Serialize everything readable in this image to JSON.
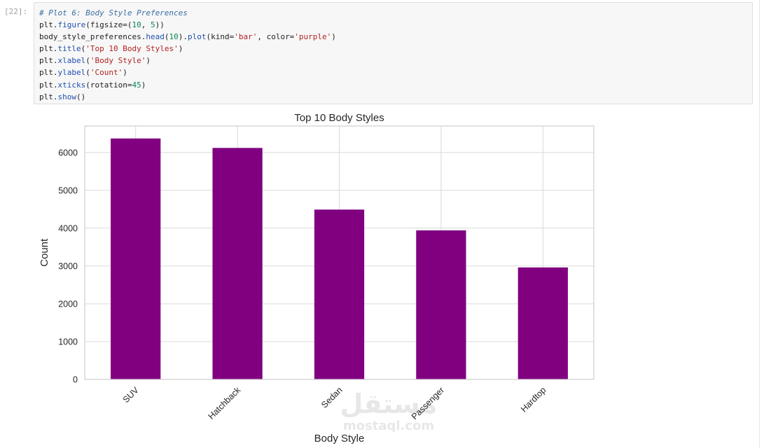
{
  "cell": {
    "prompt": "[22]:",
    "code_lines": [
      [
        {
          "t": "# Plot 6: Body Style Preferences",
          "c": "cm"
        }
      ],
      [
        {
          "t": "plt."
        },
        {
          "t": "figure",
          "c": "fn"
        },
        {
          "t": "(figsize=("
        },
        {
          "t": "10",
          "c": "nm"
        },
        {
          "t": ", "
        },
        {
          "t": "5",
          "c": "nm"
        },
        {
          "t": "))"
        }
      ],
      [
        {
          "t": "body_style_preferences."
        },
        {
          "t": "head",
          "c": "fn"
        },
        {
          "t": "("
        },
        {
          "t": "10",
          "c": "nm"
        },
        {
          "t": ")."
        },
        {
          "t": "plot",
          "c": "fn"
        },
        {
          "t": "(kind="
        },
        {
          "t": "'bar'",
          "c": "st"
        },
        {
          "t": ", color="
        },
        {
          "t": "'purple'",
          "c": "st"
        },
        {
          "t": ")"
        }
      ],
      [
        {
          "t": "plt."
        },
        {
          "t": "title",
          "c": "fn"
        },
        {
          "t": "("
        },
        {
          "t": "'Top 10 Body Styles'",
          "c": "st"
        },
        {
          "t": ")"
        }
      ],
      [
        {
          "t": "plt."
        },
        {
          "t": "xlabel",
          "c": "fn"
        },
        {
          "t": "("
        },
        {
          "t": "'Body Style'",
          "c": "st"
        },
        {
          "t": ")"
        }
      ],
      [
        {
          "t": "plt."
        },
        {
          "t": "ylabel",
          "c": "fn"
        },
        {
          "t": "("
        },
        {
          "t": "'Count'",
          "c": "st"
        },
        {
          "t": ")"
        }
      ],
      [
        {
          "t": "plt."
        },
        {
          "t": "xticks",
          "c": "fn"
        },
        {
          "t": "(rotation="
        },
        {
          "t": "45",
          "c": "nm"
        },
        {
          "t": ")"
        }
      ],
      [
        {
          "t": "plt."
        },
        {
          "t": "show",
          "c": "fn"
        },
        {
          "t": "()"
        }
      ]
    ]
  },
  "watermark": {
    "main": "مستقل",
    "sub": "mostaql.com"
  },
  "chart_data": {
    "type": "bar",
    "title": "Top 10 Body Styles",
    "xlabel": "Body Style",
    "ylabel": "Count",
    "categories": [
      "SUV",
      "Hatchback",
      "Sedan",
      "Passenger",
      "Hardtop"
    ],
    "values": [
      6370,
      6120,
      4490,
      3940,
      2960
    ],
    "ylim": [
      0,
      6700
    ],
    "yticks": [
      0,
      1000,
      2000,
      3000,
      4000,
      5000,
      6000
    ],
    "bar_color": "#800080",
    "grid": true,
    "xtick_rotation": 45
  }
}
